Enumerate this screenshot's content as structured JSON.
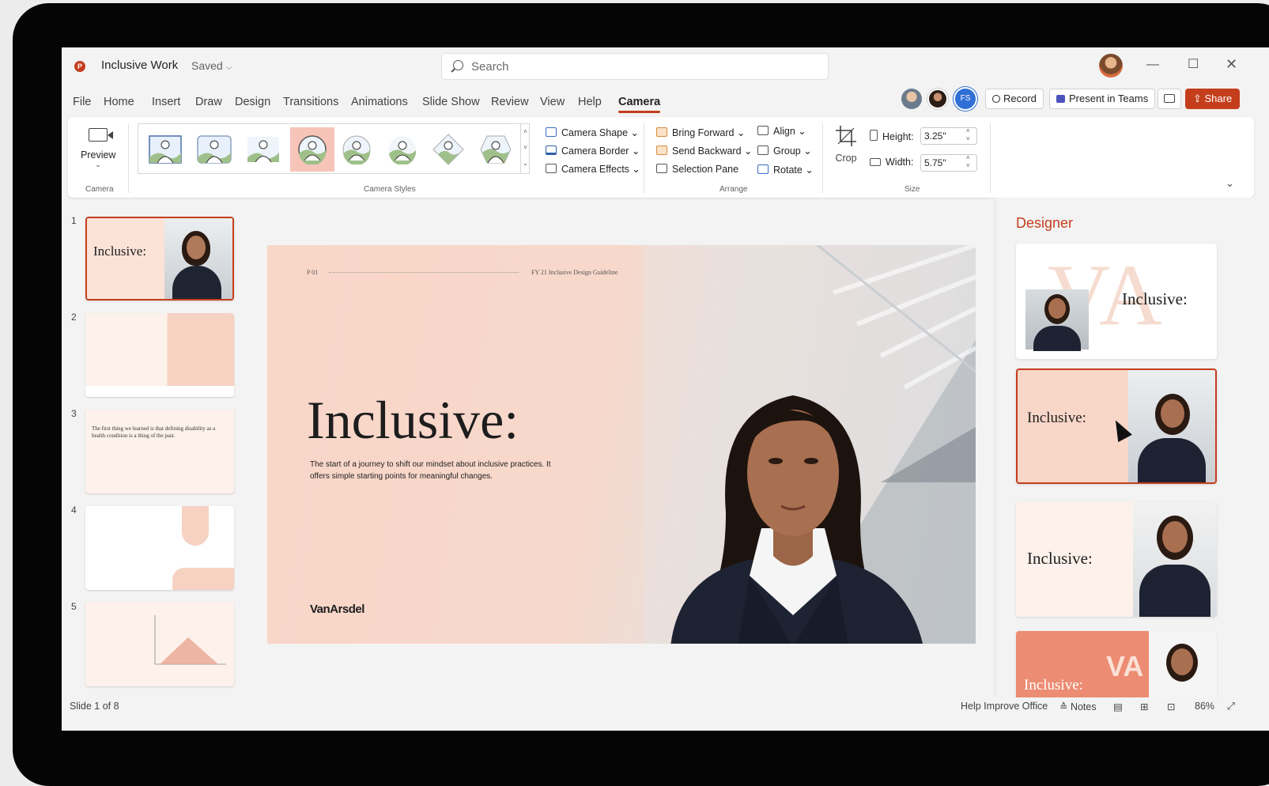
{
  "app": {
    "doc_title": "Inclusive Work",
    "saved_label": "Saved",
    "app_letter": "P",
    "search_placeholder": "Search"
  },
  "menu": [
    "File",
    "Home",
    "Insert",
    "Draw",
    "Design",
    "Transitions",
    "Animations",
    "Slide Show",
    "Review",
    "View",
    "Help",
    "Camera"
  ],
  "active_tab": "Camera",
  "header_actions": {
    "collab_initials": "FS",
    "record_label": "Record",
    "present_label": "Present in Teams",
    "share_label": "Share"
  },
  "ribbon": {
    "camera_group": {
      "preview_label": "Preview",
      "group_label": "Camera"
    },
    "styles_group": {
      "group_label": "Camera Styles",
      "selected_index": 3
    },
    "format_buttons": [
      "Camera Shape",
      "Camera Border",
      "Camera Effects"
    ],
    "arrange": {
      "bring_forward": "Bring Forward",
      "send_backward": "Send Backward",
      "selection_pane": "Selection Pane",
      "align": "Align",
      "group": "Group",
      "rotate": "Rotate",
      "group_label": "Arrange"
    },
    "crop_label": "Crop",
    "size": {
      "height_label": "Height:",
      "height_value": "3.25\"",
      "width_label": "Width:",
      "width_value": "5.75\"",
      "group_label": "Size"
    }
  },
  "thumbnails": [
    {
      "num": "1",
      "title": "Inclusive:"
    },
    {
      "num": "2"
    },
    {
      "num": "3",
      "quote": "The first thing we learned is that defining disability as a health condition is a thing of the past."
    },
    {
      "num": "4"
    },
    {
      "num": "5"
    }
  ],
  "slide": {
    "page_num": "P 01",
    "guideline": "FY 21 Inclusive Design Guideline",
    "heading": "Inclusive:",
    "subtitle": "The start of a journey to shift our mindset about inclusive practices. It offers simple starting points for meaningful changes.",
    "brand": "VanArsdel"
  },
  "designer": {
    "title": "Designer",
    "card_heading": "Inclusive:",
    "card4_logo": "VA"
  },
  "status": {
    "slide_counter": "Slide 1 of 8",
    "help_improve": "Help Improve Office",
    "notes_label": "Notes",
    "zoom": "86%"
  },
  "colors": {
    "accent": "#c43e1c",
    "slide_peach": "#f8d6c8"
  }
}
